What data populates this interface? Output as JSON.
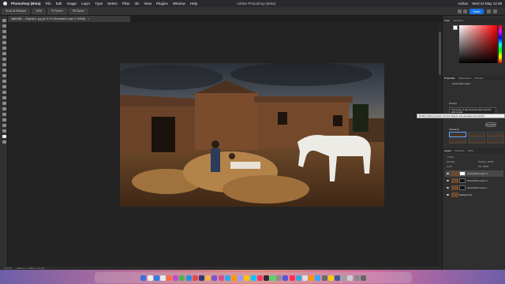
{
  "menubar": {
    "app_name": "Photoshop (Beta)",
    "items": [
      "File",
      "Edit",
      "Image",
      "Layer",
      "Type",
      "Select",
      "Filter",
      "3D",
      "View",
      "Plugins",
      "Window",
      "Help"
    ],
    "window_title": "Adobe Photoshop (Beta)",
    "clock": "Wed 24 May 12:39",
    "user": "Adrian"
  },
  "options_bar": {
    "buttons": [
      "Scroll All Windows",
      "100%",
      "Fit Screen",
      "Fill Screen"
    ],
    "share_label": "Share"
  },
  "document_tab": {
    "title": "fa8d0d55-...-Original-6...jpg @ 16.7% (Generative Layer 3, RGB/8)",
    "close": "×"
  },
  "status_bar": {
    "zoom": "16.67%",
    "doc_info": "2048 px x 1365 px (72 ppi)"
  },
  "color_panel": {
    "tabs": [
      "Color",
      "Swatches"
    ],
    "foreground_color": "#ffffff",
    "accent": "#ff0000"
  },
  "properties_panel": {
    "tabs": [
      "Properties",
      "Adjustments",
      "Libraries"
    ],
    "layer_kind": "Generative Layer",
    "prompt_label": "Prompt",
    "prompt_text": "The house of the American West and the dark clouds",
    "generate_label": "Generate",
    "variations_label": "Variations"
  },
  "tooltip": {
    "text": "Modify existing content, remove objects, and generate new content"
  },
  "layers_panel": {
    "tabs": [
      "Layers",
      "Channels",
      "Paths"
    ],
    "search_placeholder": "Kind",
    "blend_mode": "Normal",
    "opacity": "Opacity: 100%",
    "fill": "Fill: 100%",
    "lock_label": "Lock:",
    "layers": [
      {
        "name": "Generative Layer 3",
        "selected": true
      },
      {
        "name": "Generative Layer 2",
        "selected": false
      },
      {
        "name": "Generative Layer 1",
        "selected": false
      },
      {
        "name": "Background",
        "selected": false
      }
    ]
  },
  "dock": {
    "colors": [
      "#3b6fd8",
      "#f0f0f0",
      "#2f7fe0",
      "#e8e8e8",
      "#ff6f3d",
      "#c04dc7",
      "#4bb34b",
      "#2a8ee3",
      "#e34b4b",
      "#333a72",
      "#f4b63f",
      "#7a54d6",
      "#d94f8a",
      "#31a8ff",
      "#ff9a00",
      "#9999ff",
      "#ffc107",
      "#00c8ff",
      "#ff3366",
      "#2c2c2c",
      "#4cd964",
      "#8e8e93",
      "#5856d6",
      "#ff2d55",
      "#34aadc",
      "#e0e0e0",
      "#ff9500",
      "#31a8ff",
      "#6b6b6b",
      "#ffcc00",
      "#3b5998",
      "#a2a2a2",
      "#d0d0d0",
      "#8a8a8a",
      "#666666"
    ]
  }
}
